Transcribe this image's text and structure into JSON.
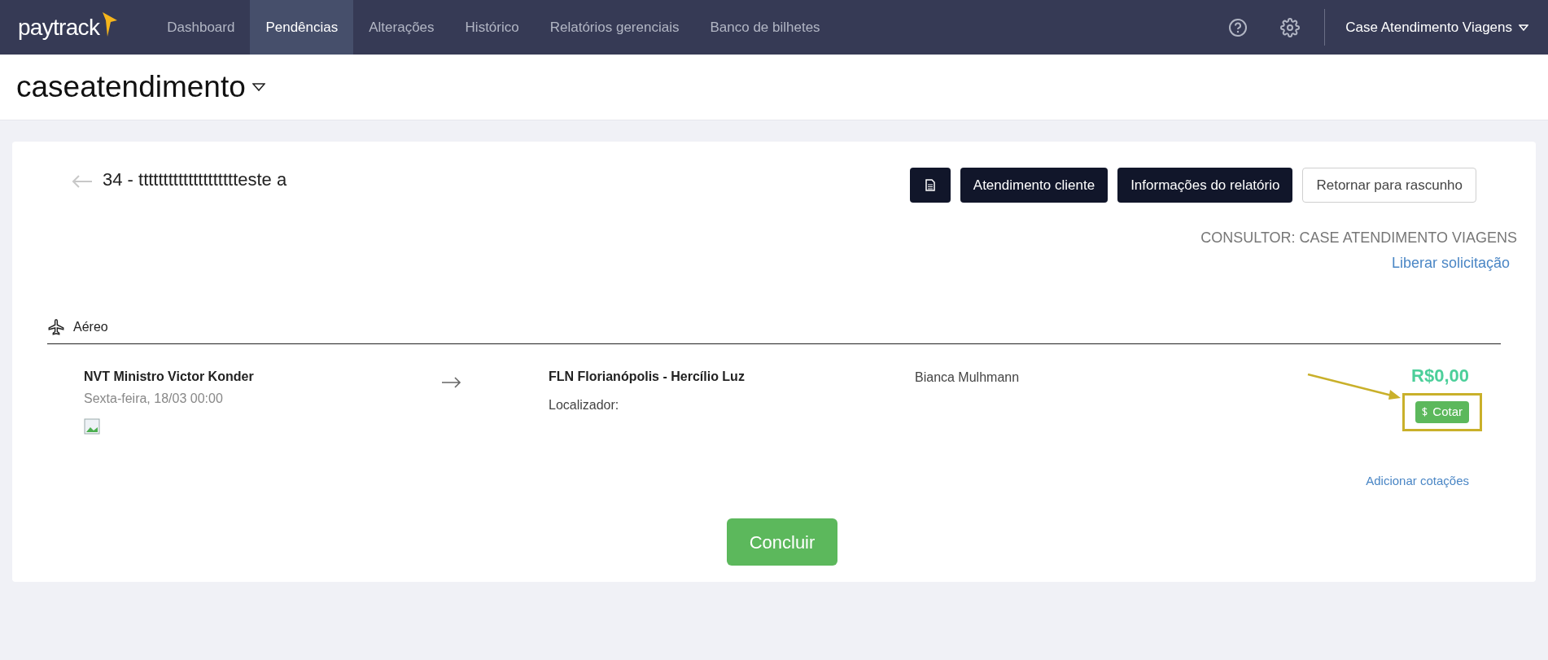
{
  "nav": {
    "logo": "paytrack",
    "items": [
      {
        "label": "Dashboard",
        "selected": false
      },
      {
        "label": "Pendências",
        "selected": true
      },
      {
        "label": "Alterações",
        "selected": false
      },
      {
        "label": "Histórico",
        "selected": false
      },
      {
        "label": "Relatórios gerenciais",
        "selected": false
      },
      {
        "label": "Banco de bilhetes",
        "selected": false
      }
    ],
    "user": "Case Atendimento Viagens"
  },
  "company": "caseatendimento",
  "report": {
    "title": "34 - tttttttttttttttttttteste a",
    "buttons": [
      {
        "kind": "icon"
      },
      {
        "kind": "dark",
        "label": "Atendimento cliente"
      },
      {
        "kind": "dark",
        "label": "Informações do relatório"
      },
      {
        "kind": "outline",
        "label": "Retornar para rascunho"
      }
    ],
    "consultant": "CONSULTOR: CASE ATENDIMENTO VIAGENS",
    "release_link": "Liberar solicitação"
  },
  "section": {
    "label": "Aéreo"
  },
  "trip": {
    "origin": "NVT Ministro Victor Konder",
    "date": "Sexta-feira, 18/03 00:00",
    "destination": "FLN Florianópolis - Hercílio Luz",
    "locator_label": "Localizador:",
    "traveler": "Bianca Mulhmann",
    "price": "R$0,00",
    "quote_button": {
      "label": "Cotar",
      "highlighted": true
    },
    "add_quotes": "Adicionar cotações"
  },
  "finish_button": "Concluir"
}
